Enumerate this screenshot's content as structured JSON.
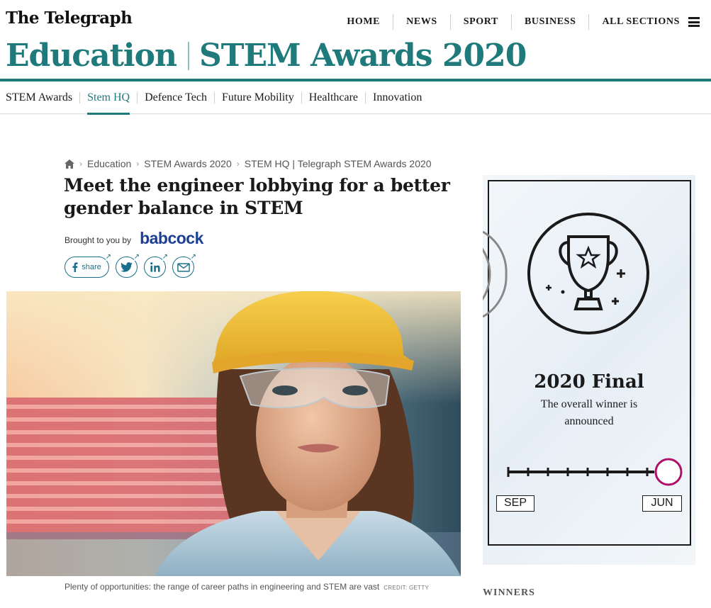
{
  "masthead": {
    "logo": "The Telegraph",
    "nav": [
      "HOME",
      "NEWS",
      "SPORT",
      "BUSINESS",
      "ALL SECTIONS"
    ],
    "section": "Education",
    "subsection": "STEM Awards 2020",
    "brand_color": "#1f7a7c"
  },
  "subnav": {
    "items": [
      "STEM Awards",
      "Stem HQ",
      "Defence Tech",
      "Future Mobility",
      "Healthcare",
      "Innovation"
    ],
    "active": "Stem HQ"
  },
  "breadcrumb": [
    "Education",
    "STEM Awards 2020",
    "STEM HQ | Telegraph STEM Awards 2020"
  ],
  "article": {
    "headline": "Meet the engineer lobbying for a better gender balance in STEM",
    "brought_label": "Brought to you by",
    "sponsor": "babcock",
    "share_label": "share",
    "caption": "Plenty of opportunities: the range of career paths in engineering and STEM are vast",
    "credit": "CREDIT: GETTY"
  },
  "promo": {
    "title": "2020 Final",
    "subtitle": "The overall winner is announced",
    "start_month": "SEP",
    "end_month": "JUN",
    "progress": 1.0,
    "accent": "#b0106a"
  },
  "sidebar": {
    "winners_label": "WINNERS"
  }
}
